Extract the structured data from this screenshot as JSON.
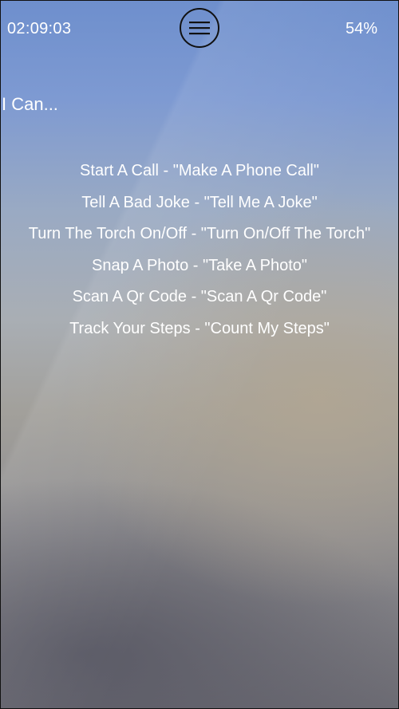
{
  "status_bar": {
    "time": "02:09:03",
    "battery": "54%"
  },
  "header": {
    "menu_icon": "hamburger-menu-icon"
  },
  "main": {
    "heading": "I Can...",
    "commands": [
      "Start A Call - \"Make A Phone Call\"",
      "Tell A Bad Joke - \"Tell Me A Joke\"",
      "Turn The Torch On/Off - \"Turn On/Off The Torch\"",
      "Snap A Photo - \"Take A Photo\"",
      "Scan A Qr Code - \"Scan A Qr Code\"",
      "Track Your Steps - \"Count My Steps\""
    ]
  },
  "colors": {
    "text": "#ffffff",
    "menu_outline": "#111111",
    "background_top": "#6e8fcd",
    "background_bottom": "#6c6b73"
  }
}
